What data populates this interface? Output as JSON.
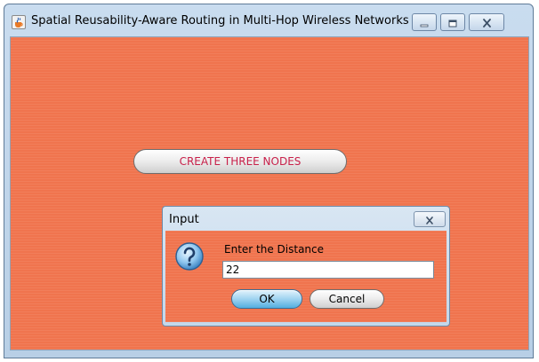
{
  "window": {
    "title": "Spatial Reusability-Aware Routing in Multi-Hop Wireless Networks",
    "icon": "java-cup-icon",
    "controls": [
      "minimize-icon",
      "maximize-icon",
      "close-icon"
    ]
  },
  "main": {
    "create_button_label": "CREATE THREE NODES",
    "background_color": "#f0744e",
    "create_button_text_color": "#c8204a"
  },
  "dialog": {
    "title": "Input",
    "icon": "question-icon",
    "prompt": "Enter the Distance",
    "input_value": "22",
    "ok_label": "OK",
    "cancel_label": "Cancel"
  }
}
